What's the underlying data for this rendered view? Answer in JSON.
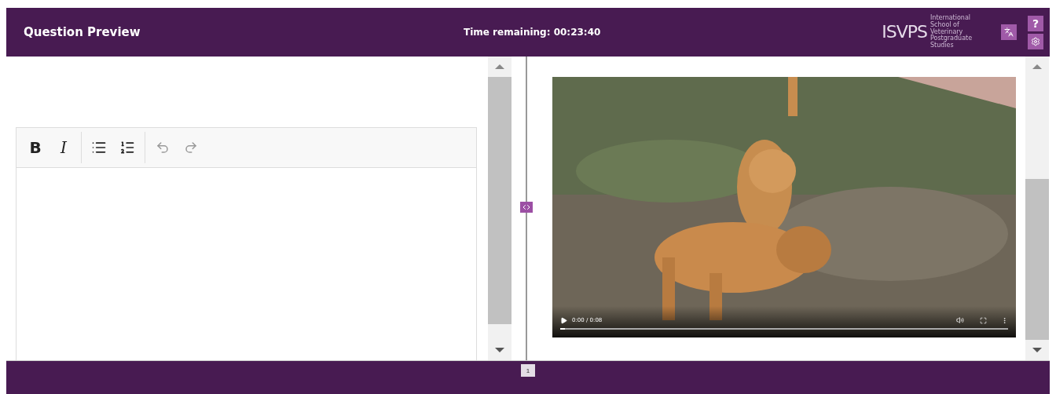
{
  "header": {
    "title": "Question Preview",
    "timer": "Time remaining: 00:23:40",
    "logo": {
      "mark": "ISVPS",
      "caption": "International School of Veterinary Postgraduate Studies"
    },
    "buttons": [
      {
        "kind": "translate"
      },
      {
        "kind": "help",
        "label": "?"
      },
      {
        "kind": "settings"
      }
    ]
  },
  "editor": {
    "toolbar": [
      {
        "kind": "bold",
        "label": "B"
      },
      {
        "kind": "italic",
        "label": "I"
      },
      {
        "kind": "divider"
      },
      {
        "kind": "bullets"
      },
      {
        "kind": "numbers"
      },
      {
        "kind": "divider"
      },
      {
        "kind": "undo"
      },
      {
        "kind": "redo"
      }
    ]
  },
  "video": {
    "time": "0:00 / 0:08",
    "level": 0.01
  },
  "pagination": [
    {
      "label": "1",
      "selected": true
    }
  ]
}
